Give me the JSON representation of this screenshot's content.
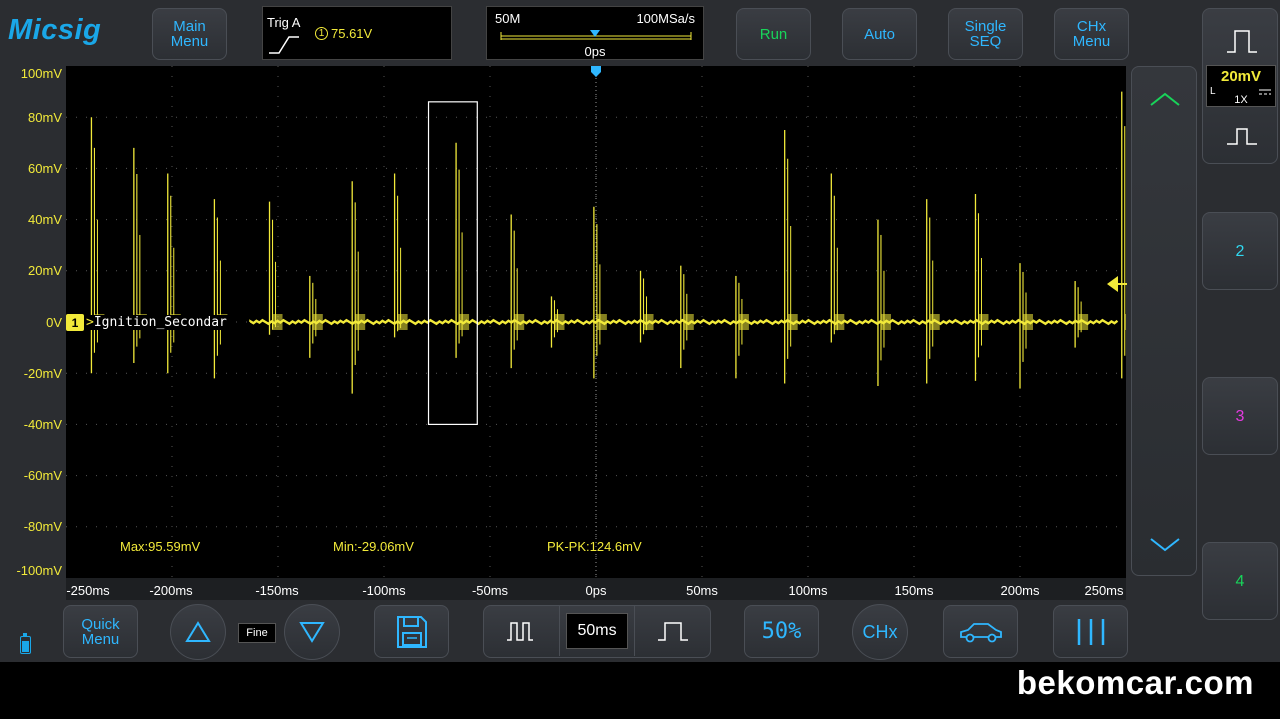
{
  "app": {
    "brand": "Micsig"
  },
  "toolbar": {
    "main_menu": "Main Menu",
    "run": "Run",
    "auto": "Auto",
    "single_seq": "Single SEQ",
    "chx_menu": "CHx Menu"
  },
  "trigger": {
    "title": "Trig A",
    "level": "75.61V",
    "source_badge": "1"
  },
  "timebox": {
    "memory_depth": "50M",
    "sample_rate": "100MSa/s",
    "trigger_position": "0ps"
  },
  "vertical": {
    "scale": "20mV",
    "coupling": "L",
    "probe": "1X"
  },
  "channel": {
    "number": "1",
    "label": "Ignition_Secondar"
  },
  "right_buttons": {
    "ch2": "2",
    "ch3": "3",
    "ch4": "4"
  },
  "bottom": {
    "quick_menu": "Quick Menu",
    "fine": "Fine",
    "timebase": "50ms",
    "fifty_percent": "50%",
    "chx": "CHx"
  },
  "measurements": {
    "max": "Max:95.59mV",
    "min": "Min:-29.06mV",
    "pkpk": "PK-PK:124.6mV"
  },
  "colors": {
    "trace": "#f2ea3a",
    "accent": "#2fb7ff",
    "run": "#18d45a",
    "ch2": "#30d8f0",
    "ch3": "#e43ae0",
    "ch4": "#18d45a"
  },
  "watermark": "bekomcar.com",
  "chart_data": {
    "type": "line",
    "title": "",
    "ylabel": "",
    "xlabel": "",
    "x_ticks": [
      "-250ms",
      "-200ms",
      "-150ms",
      "-100ms",
      "-50ms",
      "0ps",
      "50ms",
      "100ms",
      "150ms",
      "200ms",
      "250ms"
    ],
    "y_ticks": [
      "100mV",
      "80mV",
      "60mV",
      "40mV",
      "20mV",
      "0V",
      "-20mV",
      "-40mV",
      "-60mV",
      "-80mV",
      "-100mV"
    ],
    "xlim": [
      -250,
      250
    ],
    "ylim": [
      -100,
      100
    ],
    "grid": true,
    "series": [
      {
        "color": "#f2ea3a",
        "spikes_ms": [
          -238,
          -218,
          -202,
          -180,
          -154,
          -135,
          -115,
          -95,
          -66,
          -40,
          -21,
          -1,
          21,
          40,
          66,
          89,
          111,
          133,
          156,
          179,
          200,
          226,
          248
        ],
        "peak_mv": [
          80,
          68,
          58,
          48,
          47,
          18,
          55,
          58,
          70,
          42,
          10,
          45,
          20,
          22,
          18,
          75,
          58,
          40,
          48,
          50,
          23,
          16,
          90
        ],
        "trough_mv": [
          -20,
          -16,
          -20,
          -22,
          -5,
          -14,
          -28,
          -6,
          -14,
          -18,
          -10,
          -22,
          -8,
          -18,
          -22,
          -24,
          -8,
          -25,
          -24,
          -23,
          -26,
          -10,
          -22
        ]
      }
    ]
  }
}
